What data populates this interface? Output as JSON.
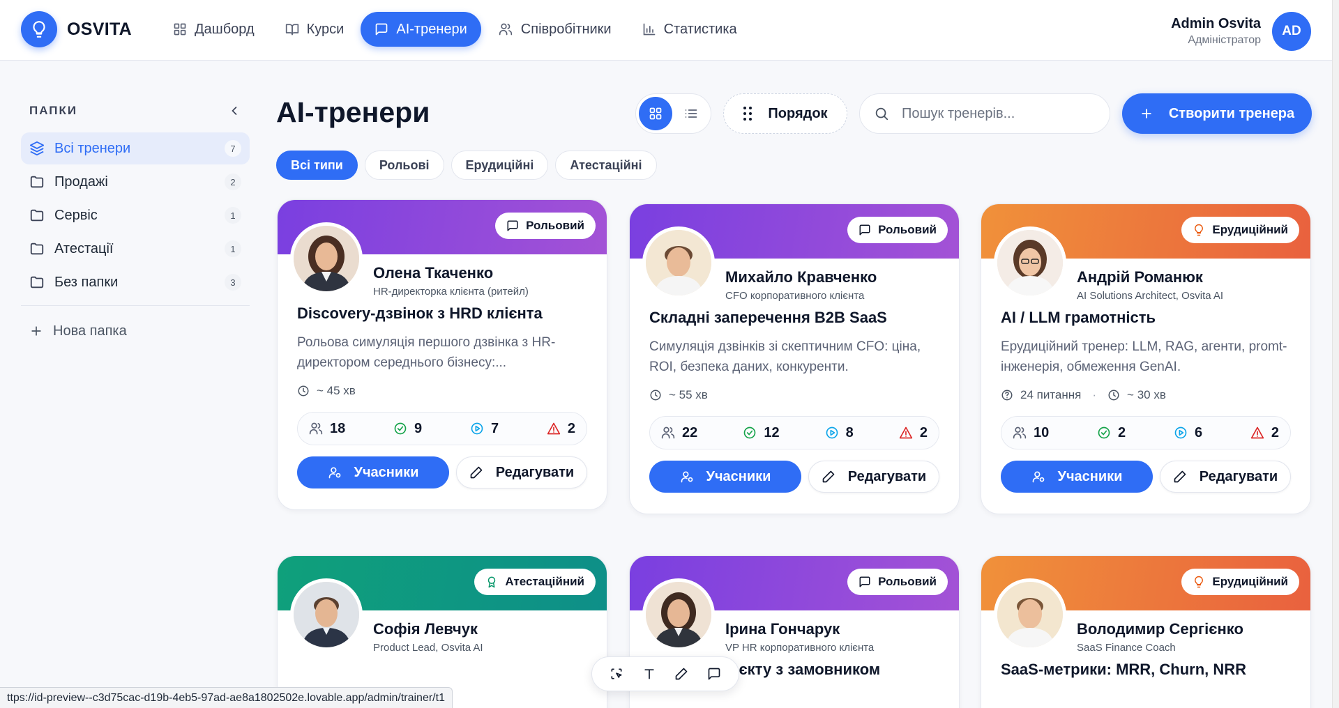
{
  "app": {
    "logo_text": "OSVITA",
    "accent_color": "#2f6df5"
  },
  "nav": [
    {
      "label": "Дашборд",
      "icon": "dashboard-icon"
    },
    {
      "label": "Курси",
      "icon": "book-icon"
    },
    {
      "label": "AI-тренери",
      "icon": "chat-icon",
      "active": true
    },
    {
      "label": "Співробітники",
      "icon": "users-icon"
    },
    {
      "label": "Статистика",
      "icon": "chart-icon"
    }
  ],
  "user": {
    "name": "Admin Osvita",
    "role": "Адміністратор",
    "initials": "AD"
  },
  "sidebar": {
    "title": "ПАПКИ",
    "folders": [
      {
        "label": "Всі тренери",
        "count": "7",
        "active": true
      },
      {
        "label": "Продажі",
        "count": "2"
      },
      {
        "label": "Сервіс",
        "count": "1"
      },
      {
        "label": "Атестації",
        "count": "1"
      },
      {
        "label": "Без папки",
        "count": "3"
      }
    ],
    "new_folder": "Нова папка"
  },
  "main": {
    "title": "AI-тренери",
    "order_label": "Порядок",
    "search_placeholder": "Пошук тренерів...",
    "create_label": "Створити тренера",
    "filters": [
      {
        "label": "Всі типи",
        "active": true
      },
      {
        "label": "Рольові"
      },
      {
        "label": "Ерудиційні"
      },
      {
        "label": "Атестаційні"
      }
    ]
  },
  "cards": [
    {
      "badge": "Рольовий",
      "theme": "purple",
      "name": "Олена Ткаченко",
      "role": "HR-директорка клієнта (ритейл)",
      "title": "Discovery-дзвінок з HRD клієнта",
      "desc": "Рольова симуляція першого дзвінка з HR-директором середнього бізнесу:...",
      "questions": "",
      "duration": "~ 45 хв",
      "participants": "18",
      "completed": "9",
      "in_progress": "7",
      "issues": "2",
      "btn_participants": "Учасники",
      "btn_edit": "Редагувати"
    },
    {
      "badge": "Рольовий",
      "theme": "purple",
      "name": "Михайло Кравченко",
      "role": "CFO корпоративного клієнта",
      "title": "Складні заперечення B2B SaaS",
      "desc": "Симуляція дзвінків зі скептичним CFO: ціна, ROI, безпека даних, конкуренти.",
      "questions": "",
      "duration": "~ 55 хв",
      "participants": "22",
      "completed": "12",
      "in_progress": "8",
      "issues": "2",
      "btn_participants": "Учасники",
      "btn_edit": "Редагувати"
    },
    {
      "badge": "Ерудиційний",
      "theme": "orange",
      "name": "Андрій Романюк",
      "role": "AI Solutions Architect, Osvita AI",
      "title": "AI / LLM грамотність",
      "desc": "Ерудиційний тренер: LLM, RAG, агенти, promt-інженерія, обмеження GenAI.",
      "questions": "24 питання",
      "duration": "~ 30 хв",
      "participants": "10",
      "completed": "2",
      "in_progress": "6",
      "issues": "2",
      "btn_participants": "Учасники",
      "btn_edit": "Редагувати"
    },
    {
      "badge": "Атестаційний",
      "theme": "green",
      "name": "Софія Левчук",
      "role": "Product Lead, Osvita AI",
      "title": ""
    },
    {
      "badge": "Рольовий",
      "theme": "purple",
      "name": "Ірина Гончарук",
      "role": "VP HR корпоративного клієнта",
      "title": "Кікофф проєкту з замовником"
    },
    {
      "badge": "Ерудиційний",
      "theme": "orange",
      "name": "Володимир Сергієнко",
      "role": "SaaS Finance Coach",
      "title": "SaaS-метрики: MRR, Churn, NRR"
    }
  ],
  "status_url": "ttps://id-preview--c3d75cac-d19b-4eb5-97ad-ae8a1802502e.lovable.app/admin/trainer/t1"
}
